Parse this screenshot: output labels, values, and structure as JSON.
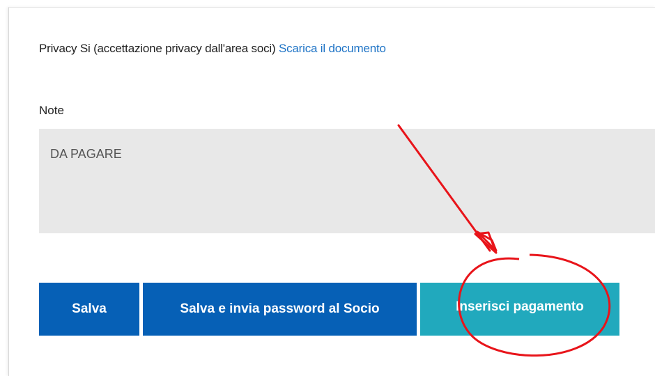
{
  "privacy": {
    "text": "Privacy Si (accettazione privacy dall'area soci)",
    "link_label": "Scarica il documento"
  },
  "note": {
    "label": "Note",
    "value": "DA PAGARE"
  },
  "buttons": {
    "save": "Salva",
    "save_and_send": "Salva e invia password al Socio",
    "insert_payment": "Inserisci pagamento"
  },
  "colors": {
    "primary_button": "#0660b6",
    "payment_button": "#21a9bd",
    "link": "#1f74c6",
    "annotation": "#e8141a"
  },
  "annotation": {
    "arrow": "red-arrow-icon",
    "highlight": "red-ellipse-icon"
  }
}
